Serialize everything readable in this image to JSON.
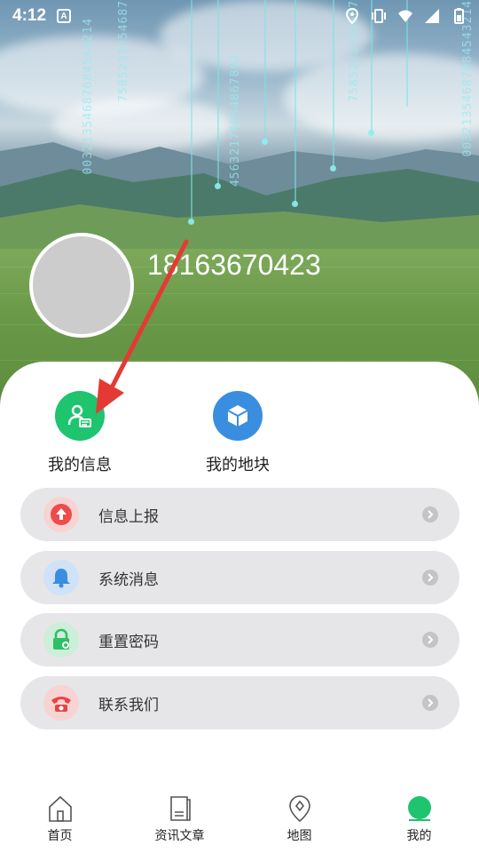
{
  "status_bar": {
    "time": "4:12",
    "a_badge": "A",
    "icons": [
      "location-icon",
      "vibrate-icon",
      "wifi-icon",
      "signal-icon",
      "battery-icon"
    ]
  },
  "profile": {
    "phone": "18163670423"
  },
  "hero": {
    "digit_strings": [
      "00321354687684543214",
      "7585231354687",
      "45632176854867892",
      "00321354687684543214",
      "7585231354687"
    ]
  },
  "quick_actions": [
    {
      "label": "我的信息",
      "icon": "user-info-icon",
      "color": "#1fc46e"
    },
    {
      "label": "我的地块",
      "icon": "cube-icon",
      "color": "#3a8ee0"
    }
  ],
  "menu": [
    {
      "label": "信息上报",
      "icon": "upload-icon",
      "color": "#ee4b4b"
    },
    {
      "label": "系统消息",
      "icon": "bell-icon",
      "color": "#3a8ee0"
    },
    {
      "label": "重置密码",
      "icon": "lock-icon",
      "color": "#2fbf66"
    },
    {
      "label": "联系我们",
      "icon": "phone-icon",
      "color": "#e84343"
    }
  ],
  "bottom_nav": [
    {
      "label": "首页",
      "icon": "home-icon"
    },
    {
      "label": "资讯文章",
      "icon": "article-icon"
    },
    {
      "label": "地图",
      "icon": "map-pin-icon"
    },
    {
      "label": "我的",
      "icon": "profile-icon",
      "active": true
    }
  ],
  "colors": {
    "accent": "#1fc46e",
    "menu_bg": "#e6e6e8",
    "annotation": "#e53935"
  }
}
